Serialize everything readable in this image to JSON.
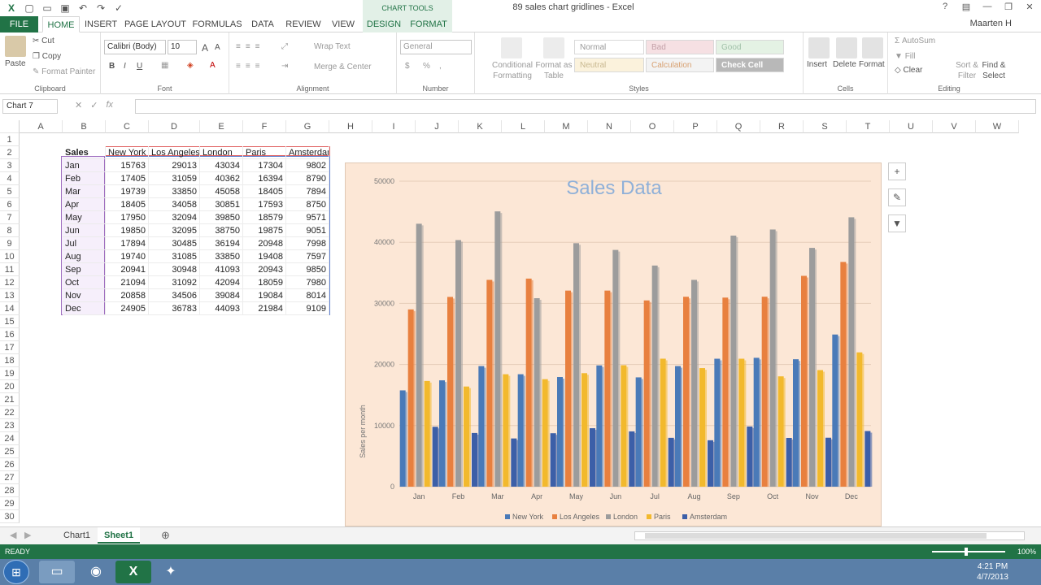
{
  "titlebar": {
    "title": "89 sales chart gridlines - Excel",
    "chart_tools_label": "CHART TOOLS",
    "user": "Maarten H"
  },
  "tabs": [
    "FILE",
    "HOME",
    "INSERT",
    "PAGE LAYOUT",
    "FORMULAS",
    "DATA",
    "REVIEW",
    "VIEW",
    "DESIGN",
    "FORMAT"
  ],
  "ribbon": {
    "clipboard": {
      "label": "Clipboard",
      "paste": "Paste",
      "cut": "Cut",
      "copy": "Copy",
      "format_painter": "Format Painter"
    },
    "font": {
      "label": "Font",
      "family": "Calibri (Body)",
      "size": "10",
      "bold": "B",
      "italic": "I",
      "underline": "U"
    },
    "alignment": {
      "label": "Alignment",
      "wrap": "Wrap Text",
      "merge": "Merge & Center"
    },
    "number": {
      "label": "Number",
      "format": "General",
      "currency": "$",
      "percent": "%",
      "comma": ","
    },
    "styles": {
      "label": "Styles",
      "conditional": "Conditional Formatting",
      "format_table": "Format as Table",
      "cells": [
        "Normal",
        "Bad",
        "Good",
        "Neutral",
        "Calculation",
        "Check Cell"
      ]
    },
    "cells": {
      "label": "Cells",
      "insert": "Insert",
      "delete": "Delete",
      "format": "Format"
    },
    "editing": {
      "label": "Editing",
      "autosum": "AutoSum",
      "fill": "Fill",
      "clear": "Clear",
      "sort": "Sort & Filter",
      "find": "Find & Select"
    }
  },
  "formula_bar": {
    "name_box": "Chart 7",
    "fx": "fx",
    "value": ""
  },
  "columns": [
    "A",
    "B",
    "C",
    "D",
    "E",
    "F",
    "G",
    "H",
    "I",
    "J",
    "K",
    "L",
    "M",
    "N",
    "O",
    "P",
    "Q",
    "R",
    "S",
    "T",
    "U",
    "V",
    "W"
  ],
  "rows": [
    "1",
    "2",
    "3",
    "4",
    "5",
    "6",
    "7",
    "8",
    "9",
    "10",
    "11",
    "12",
    "13",
    "14",
    "15",
    "16",
    "17",
    "18",
    "19",
    "20",
    "21",
    "22",
    "23",
    "24",
    "25",
    "26",
    "27",
    "28",
    "29",
    "30"
  ],
  "table": {
    "header": [
      "Sales",
      "New York",
      "Los Angeles",
      "London",
      "Paris",
      "Amsterdam"
    ],
    "rows": [
      [
        "Jan",
        "15763",
        "29013",
        "43034",
        "17304",
        "9802"
      ],
      [
        "Feb",
        "17405",
        "31059",
        "40362",
        "16394",
        "8790"
      ],
      [
        "Mar",
        "19739",
        "33850",
        "45058",
        "18405",
        "7894"
      ],
      [
        "Apr",
        "18405",
        "34058",
        "30851",
        "17593",
        "8750"
      ],
      [
        "May",
        "17950",
        "32094",
        "39850",
        "18579",
        "9571"
      ],
      [
        "Jun",
        "19850",
        "32095",
        "38750",
        "19875",
        "9051"
      ],
      [
        "Jul",
        "17894",
        "30485",
        "36194",
        "20948",
        "7998"
      ],
      [
        "Aug",
        "19740",
        "31085",
        "33850",
        "19408",
        "7597"
      ],
      [
        "Sep",
        "20941",
        "30948",
        "41093",
        "20943",
        "9850"
      ],
      [
        "Oct",
        "21094",
        "31092",
        "42094",
        "18059",
        "7980"
      ],
      [
        "Nov",
        "20858",
        "34506",
        "39084",
        "19084",
        "8014"
      ],
      [
        "Dec",
        "24905",
        "36783",
        "44093",
        "21984",
        "9109"
      ]
    ]
  },
  "chart_data": {
    "type": "bar",
    "title": "Sales Data",
    "xlabel": "",
    "ylabel": "Sales per month",
    "ylim": [
      0,
      50000
    ],
    "yticks": [
      "0",
      "10000",
      "20000",
      "30000",
      "40000",
      "50000"
    ],
    "grid": true,
    "legend": "bottom",
    "categories": [
      "Jan",
      "Feb",
      "Mar",
      "Apr",
      "May",
      "Jun",
      "Jul",
      "Aug",
      "Sep",
      "Oct",
      "Nov",
      "Dec"
    ],
    "series": [
      {
        "name": "New York",
        "color": "#4a7ab8",
        "values": [
          15763,
          17405,
          19739,
          18405,
          17950,
          19850,
          17894,
          19740,
          20941,
          21094,
          20858,
          24905
        ]
      },
      {
        "name": "Los Angeles",
        "color": "#e8803f",
        "values": [
          29013,
          31059,
          33850,
          34058,
          32094,
          32095,
          30485,
          31085,
          30948,
          31092,
          34506,
          36783
        ]
      },
      {
        "name": "London",
        "color": "#9c9c9c",
        "values": [
          43034,
          40362,
          45058,
          30851,
          39850,
          38750,
          36194,
          33850,
          41093,
          42094,
          39084,
          44093
        ]
      },
      {
        "name": "Paris",
        "color": "#f2b92d",
        "values": [
          17304,
          16394,
          18405,
          17593,
          18579,
          19875,
          20948,
          19408,
          20943,
          18059,
          19084,
          21984
        ]
      },
      {
        "name": "Amsterdam",
        "color": "#3c5fa8",
        "values": [
          9802,
          8790,
          7894,
          8750,
          9571,
          9051,
          7998,
          7597,
          9850,
          7980,
          8014,
          9109
        ]
      }
    ]
  },
  "sheets": [
    "Chart1",
    "Sheet1"
  ],
  "status": {
    "ready": "READY",
    "zoom": "100%"
  },
  "taskbar": {
    "time": "4:21 PM",
    "date": "4/7/2013"
  }
}
